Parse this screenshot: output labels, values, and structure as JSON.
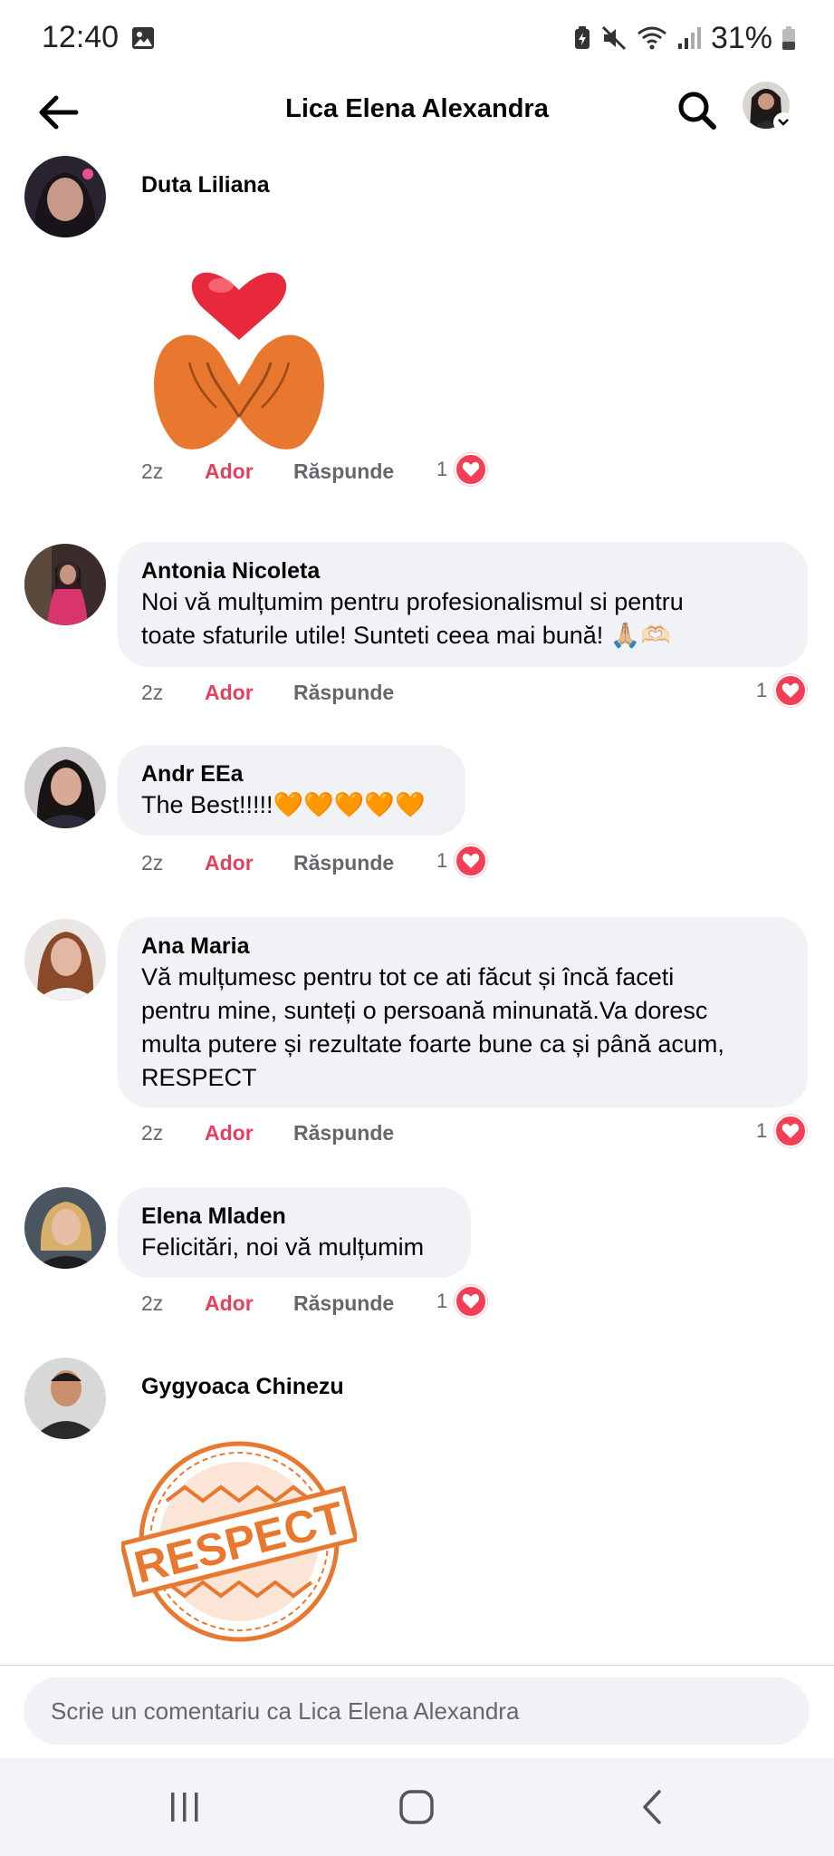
{
  "status": {
    "time": "12:40",
    "battery_percent": "31%",
    "icons": [
      "gallery-icon",
      "battery-saver-icon",
      "mute-icon",
      "wifi-icon",
      "signal-icon",
      "battery-icon"
    ]
  },
  "header": {
    "title": "Lica Elena Alexandra",
    "back_icon": "arrow-left-icon",
    "search_icon": "search-icon",
    "profile_icon": "profile-avatar"
  },
  "comments": [
    {
      "author": "Duta Liliana",
      "text": "",
      "attachment": "hands-heart-sticker",
      "time": "2z",
      "love_label": "Ador",
      "reply_label": "Răspunde",
      "reaction_count": "1"
    },
    {
      "author": "Antonia Nicoleta",
      "text_lines": [
        "Noi vă mulțumim pentru profesionalismul si pentru",
        "toate sfaturile utile! Sunteti ceea mai bună! 🙏🏼🫶🏻"
      ],
      "time": "2z",
      "love_label": "Ador",
      "reply_label": "Răspunde",
      "reaction_count": "1"
    },
    {
      "author": "Andr EEa",
      "text_lines": [
        "The Best!!!!!🧡🧡🧡🧡🧡"
      ],
      "time": "2z",
      "love_label": "Ador",
      "reply_label": "Răspunde",
      "reaction_count": "1"
    },
    {
      "author": "Ana Maria",
      "text_lines": [
        "Vă mulțumesc pentru tot ce ati făcut și încă faceti",
        "pentru mine, sunteți o persoană minunată.Va doresc",
        "multa putere și rezultate foarte bune ca și până acum,",
        "RESPECT"
      ],
      "time": "2z",
      "love_label": "Ador",
      "reply_label": "Răspunde",
      "reaction_count": "1"
    },
    {
      "author": "Elena Mladen",
      "text_lines": [
        "Felicitări, noi vă mulțumim"
      ],
      "time": "2z",
      "love_label": "Ador",
      "reply_label": "Răspunde",
      "reaction_count": "1"
    },
    {
      "author": "Gygyoaca Chinezu",
      "attachment": "respect-stamp-sticker",
      "sticker_text": "RESPECT"
    }
  ],
  "compose": {
    "placeholder": "Scrie un comentariu ca Lica Elena Alexandra"
  },
  "navbar": {
    "recent_icon": "recent-apps-icon",
    "home_icon": "home-icon",
    "back_icon": "nav-back-icon"
  },
  "colors": {
    "love": "#e4405f",
    "heart": "#f33e58",
    "bubble": "#f0f2f5",
    "muted": "#65676b",
    "sticker_orange": "#e8782f"
  }
}
